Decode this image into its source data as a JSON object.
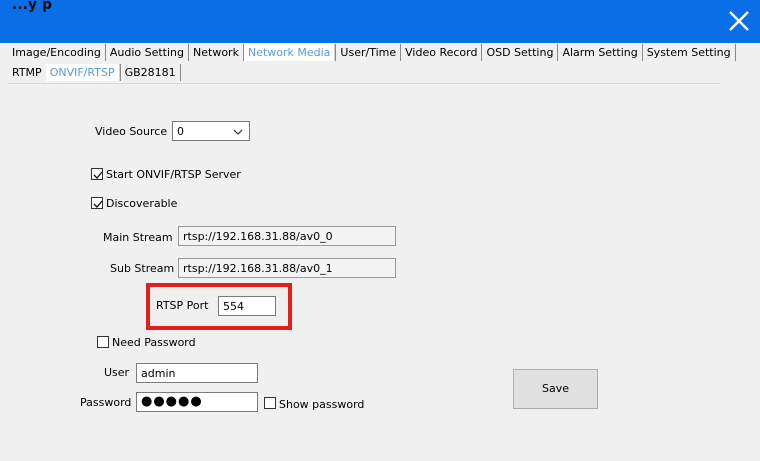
{
  "window": {
    "caption": "...y p"
  },
  "main_tabs": [
    {
      "label": "Image/Encoding",
      "active": false
    },
    {
      "label": "Audio Setting",
      "active": false
    },
    {
      "label": "Network",
      "active": false
    },
    {
      "label": "Network Media",
      "active": true
    },
    {
      "label": "User/Time",
      "active": false
    },
    {
      "label": "Video Record",
      "active": false
    },
    {
      "label": "OSD Setting",
      "active": false
    },
    {
      "label": "Alarm Setting",
      "active": false
    },
    {
      "label": "System Setting",
      "active": false
    }
  ],
  "sub_tabs": [
    {
      "label": "RTMP",
      "active": false
    },
    {
      "label": "ONVIF/RTSP",
      "active": true
    },
    {
      "label": "GB28181",
      "active": false
    }
  ],
  "form": {
    "video_source": {
      "label": "Video Source",
      "value": "0"
    },
    "start_server": {
      "label": "Start ONVIF/RTSP Server",
      "checked": true
    },
    "discoverable": {
      "label": "Discoverable",
      "checked": true
    },
    "main_stream": {
      "label": "Main Stream",
      "value": "rtsp://192.168.31.88/av0_0"
    },
    "sub_stream": {
      "label": "Sub Stream",
      "value": "rtsp://192.168.31.88/av0_1"
    },
    "rtsp_port": {
      "label": "RTSP Port",
      "value": "554"
    },
    "need_password": {
      "label": "Need Password",
      "checked": false
    },
    "user": {
      "label": "User",
      "value": "admin"
    },
    "password": {
      "label": "Password",
      "masked_value": "●●●●●"
    },
    "show_password": {
      "label": "Show password",
      "checked": false
    },
    "save_label": "Save"
  },
  "colors": {
    "titlebar": "#0a6fe6",
    "highlight_frame": "#e41d1d",
    "active_tab_text": "#5b9bd5"
  }
}
